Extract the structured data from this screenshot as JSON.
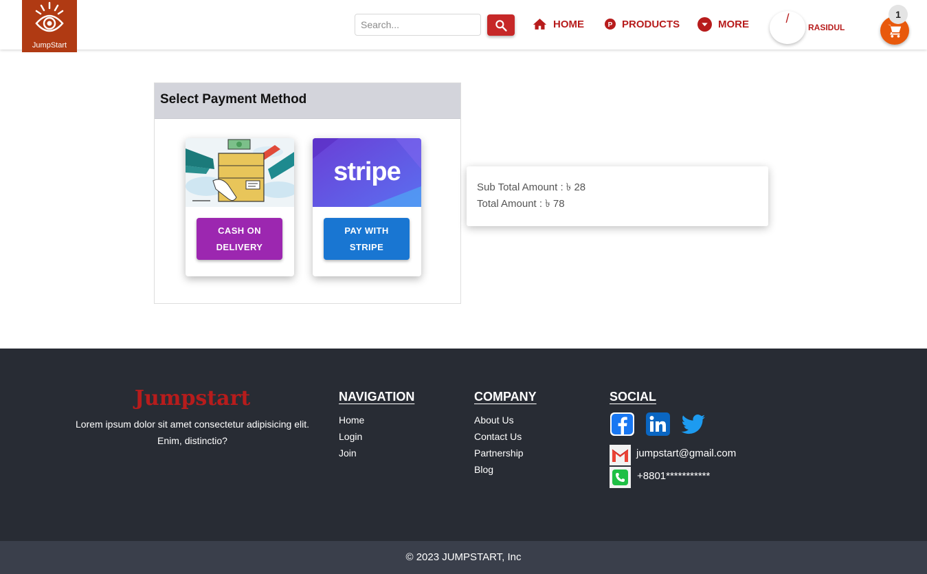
{
  "header": {
    "logo_text": "JumpStart",
    "search_placeholder": "Search...",
    "nav": {
      "home": "HOME",
      "products": "PRODUCTS",
      "more": "MORE"
    },
    "avatar_glyph": "/",
    "username": "RASIDUL",
    "cart_count": "1"
  },
  "payment": {
    "title": "Select Payment Method",
    "cod_button_line1": "CASH ON",
    "cod_button_line2": "DELIVERY",
    "stripe_logo": "stripe",
    "stripe_button_line1": "PAY WITH",
    "stripe_button_line2": "STRIPE"
  },
  "summary": {
    "subtotal": "Sub Total Amount : ৳ 28",
    "total": "Total Amount : ৳ 78"
  },
  "footer": {
    "brand": "Jumpstart",
    "description": "Lorem ipsum dolor sit amet consectetur adipisicing elit. Enim, distinctio?",
    "navigation": {
      "heading": "NAVIGATION",
      "links": [
        "Home",
        "Login",
        "Join"
      ]
    },
    "company": {
      "heading": "COMPANY",
      "links": [
        "About Us",
        "Contact Us",
        "Partnership",
        "Blog"
      ]
    },
    "social": {
      "heading": "SOCIAL",
      "icons": [
        "facebook-icon",
        "linkedin-icon",
        "twitter-icon"
      ],
      "email": "jumpstart@gmail.com",
      "phone": "+8801***********"
    },
    "copyright": "© 2023 JUMPSTART, Inc"
  },
  "colors": {
    "brand_red": "#b71c1c",
    "logo_bg": "#b03a13",
    "cod_purple": "#9c27b0",
    "stripe_blue": "#1976d2",
    "footer_bg": "#282c34",
    "cart_orange": "#e8590c"
  }
}
